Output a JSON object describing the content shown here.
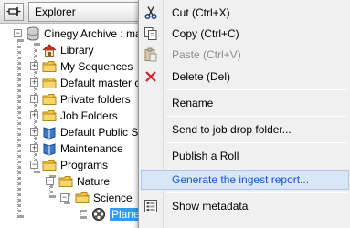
{
  "header": {
    "pin_icon": "pin-icon",
    "title": "Explorer"
  },
  "tree": {
    "root": {
      "label": "Cinegy Archive : ma",
      "icon": "database-icon"
    },
    "items": [
      {
        "label": "Library",
        "icon": "house-icon"
      },
      {
        "label": "My Sequences",
        "icon": "folder-icon"
      },
      {
        "label": "Default master c",
        "icon": "folder-icon"
      },
      {
        "label": "Private folders",
        "icon": "folder-icon"
      },
      {
        "label": "Job Folders",
        "icon": "folder-icon"
      },
      {
        "label": "Default Public Se",
        "icon": "book-icon"
      },
      {
        "label": "Maintenance",
        "icon": "book-icon"
      },
      {
        "label": "Programs",
        "icon": "folder-icon"
      },
      {
        "label": "Nature",
        "icon": "folder-icon"
      },
      {
        "label": "Science",
        "icon": "folder-icon"
      },
      {
        "label": "Plane",
        "icon": "film-reel-icon"
      }
    ]
  },
  "context_menu": {
    "items": [
      {
        "label": "Cut (Ctrl+X)",
        "icon": "scissors-icon"
      },
      {
        "label": "Copy (Ctrl+C)",
        "icon": "copy-icon"
      },
      {
        "label": "Paste (Ctrl+V)",
        "icon": "paste-icon",
        "disabled": true
      },
      {
        "label": "Delete (Del)",
        "icon": "delete-icon"
      },
      {
        "label": "Rename"
      },
      {
        "label": "Send to job drop folder..."
      },
      {
        "label": "Publish a Roll"
      },
      {
        "label": "Generate the ingest report...",
        "highlighted": true
      },
      {
        "label": "Show metadata",
        "icon": "metadata-icon"
      }
    ]
  },
  "colors": {
    "selection": "#3399ff",
    "menu_highlight": "#d8e6f7",
    "menu_highlight_text": "#1a56c8",
    "folder": "#f5c542",
    "delete": "#d0202a"
  }
}
